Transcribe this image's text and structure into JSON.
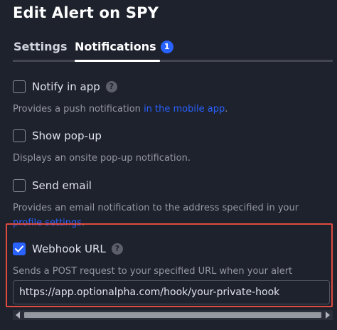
{
  "dialog": {
    "title": "Edit Alert on SPY"
  },
  "tabs": [
    {
      "label": "Settings",
      "active": false
    },
    {
      "label": "Notifications",
      "active": true,
      "badge": "1"
    }
  ],
  "options": {
    "notify_in_app": {
      "label": "Notify in app",
      "checked": false,
      "desc_before": "Provides a push notification ",
      "desc_link": "in the mobile app",
      "desc_after": "."
    },
    "show_popup": {
      "label": "Show pop-up",
      "checked": false,
      "desc": "Displays an onsite pop-up notification."
    },
    "send_email": {
      "label": "Send email",
      "checked": false,
      "desc_before": "Provides an email notification to the address specified in your ",
      "desc_link": "profile settings",
      "desc_after": "."
    },
    "webhook": {
      "label": "Webhook URL",
      "checked": true,
      "desc": "Sends a POST request to your specified URL when your alert triggers.",
      "url_value": "https://app.optionalpha.com/hook/your-private-hook"
    }
  },
  "icons": {
    "help": "?"
  },
  "colors": {
    "background": "#1e222d",
    "accent": "#2962ff",
    "highlight_border": "#e04a3f",
    "muted_text": "#9598a1"
  }
}
